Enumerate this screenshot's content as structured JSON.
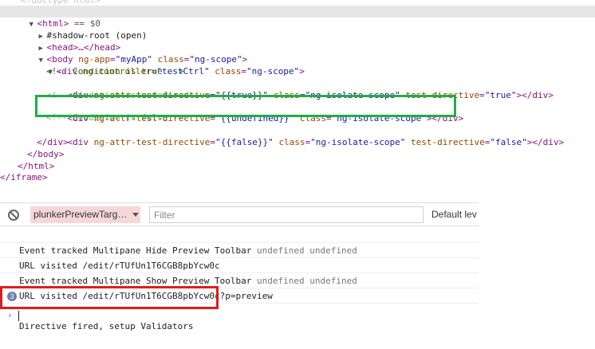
{
  "elements_panel": {
    "doctype_line": "<!doctype html>",
    "html_open": "<html>",
    "selected_marker": "== $0",
    "lines": {
      "shadow_root": "#shadow-root (open)",
      "head": "<head>…</head>",
      "body_tag": "<body",
      "body_app_attr": "ng-app",
      "body_app_val": "\"myApp\"",
      "body_class_attr": "class",
      "body_class_val": "\"ng-scope\"",
      "div_tag": "<div",
      "div_ctrl_attr": "ng-controller",
      "div_ctrl_val": "\"testCtrl\"",
      "div_class_attr": "class",
      "div_class_val": "\"ng-scope\"",
      "comment_true": "<!-- Condition is true -->",
      "test_true_attr1": "ng-attr-test-directive",
      "test_true_val1": "\"{{true}}\"",
      "test_true_attr2": "class",
      "test_true_val2": "\"ng-isolate-scope\"",
      "test_true_attr3": "test-directive",
      "test_true_val3": "\"true\"",
      "comment_undefined": "<!-- Condition is undefined -->",
      "test_undef_attr1": "ng-attr-test-directive",
      "test_undef_val1": "\"{{undefined}}\"",
      "test_undef_attr2": "class",
      "test_undef_val2": "\"ng-isolate-scope\"",
      "comment_false": "<!-- Condition is false -->",
      "test_false_attr1": "ng-attr-test-directive",
      "test_false_val1": "\"{{false}}\"",
      "test_false_attr2": "class",
      "test_false_val2": "\"ng-isolate-scope\"",
      "test_false_attr3": "test-directive",
      "test_false_val3": "\"false\"",
      "div_end": "</div>",
      "inner_div_end": "</div>",
      "body_end": "</body>",
      "html_end": "</html>",
      "iframe_end": "</iframe>"
    }
  },
  "console": {
    "context_selector": "plunkerPreviewTarg…",
    "filter_placeholder": "Filter",
    "levels_label": "Default lev",
    "messages": [
      {
        "text": "Event tracked Multipane Hide Preview Toolbar",
        "extra": "undefined undefined"
      },
      {
        "text": "URL visited /edit/rTUfUn1T6CGB8pbYcw0c",
        "extra": ""
      },
      {
        "text": "Event tracked Multipane Show Preview Toolbar",
        "extra": "undefined undefined"
      },
      {
        "text": "URL visited /edit/rTUfUn1T6CGB8pbYcw0c?p=preview",
        "extra": ""
      }
    ],
    "highlight_message": {
      "count": "3",
      "text": "Directive fired, setup Validators"
    },
    "prompt_symbol": "›"
  },
  "colors": {
    "highlight_green": "#1fae44",
    "highlight_red": "#e41b1b",
    "tag": "#881280",
    "attr_name": "#994500",
    "attr_value": "#1a1aa6",
    "comment": "#236e25"
  }
}
